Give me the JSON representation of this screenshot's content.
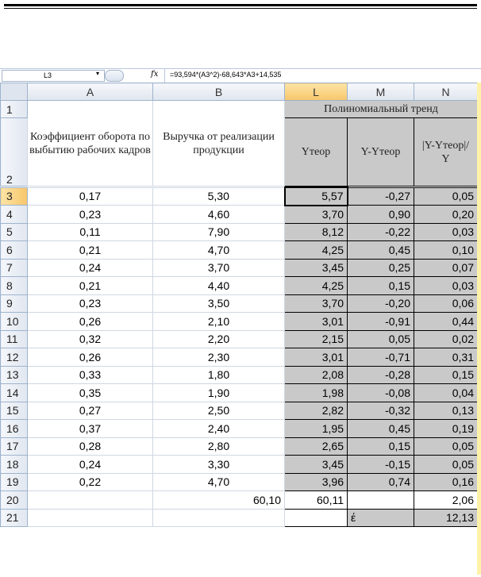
{
  "formula_bar": {
    "cell": "L3",
    "fx_label": "fx",
    "formula": "=93,594*(A3^2)-68,643*A3+14,535"
  },
  "columns": [
    "A",
    "B",
    "L",
    "M",
    "N"
  ],
  "header": {
    "a": "Коэффициент оборота по выбытию рабочих кадров",
    "b": "Выручка от реализации продукции",
    "trend_title": "Полиномиальный тренд",
    "l": "Yтеор",
    "m": "Y-Yтеор",
    "n": "|Y-Yтеор|/Y"
  },
  "rows": [
    {
      "r": "3",
      "a": "0,17",
      "b": "5,30",
      "l": "5,57",
      "m": "-0,27",
      "n": "0,05"
    },
    {
      "r": "4",
      "a": "0,23",
      "b": "4,60",
      "l": "3,70",
      "m": "0,90",
      "n": "0,20"
    },
    {
      "r": "5",
      "a": "0,11",
      "b": "7,90",
      "l": "8,12",
      "m": "-0,22",
      "n": "0,03"
    },
    {
      "r": "6",
      "a": "0,21",
      "b": "4,70",
      "l": "4,25",
      "m": "0,45",
      "n": "0,10"
    },
    {
      "r": "7",
      "a": "0,24",
      "b": "3,70",
      "l": "3,45",
      "m": "0,25",
      "n": "0,07"
    },
    {
      "r": "8",
      "a": "0,21",
      "b": "4,40",
      "l": "4,25",
      "m": "0,15",
      "n": "0,03"
    },
    {
      "r": "9",
      "a": "0,23",
      "b": "3,50",
      "l": "3,70",
      "m": "-0,20",
      "n": "0,06"
    },
    {
      "r": "10",
      "a": "0,26",
      "b": "2,10",
      "l": "3,01",
      "m": "-0,91",
      "n": "0,44"
    },
    {
      "r": "11",
      "a": "0,32",
      "b": "2,20",
      "l": "2,15",
      "m": "0,05",
      "n": "0,02"
    },
    {
      "r": "12",
      "a": "0,26",
      "b": "2,30",
      "l": "3,01",
      "m": "-0,71",
      "n": "0,31"
    },
    {
      "r": "13",
      "a": "0,33",
      "b": "1,80",
      "l": "2,08",
      "m": "-0,28",
      "n": "0,15"
    },
    {
      "r": "14",
      "a": "0,35",
      "b": "1,90",
      "l": "1,98",
      "m": "-0,08",
      "n": "0,04"
    },
    {
      "r": "15",
      "a": "0,27",
      "b": "2,50",
      "l": "2,82",
      "m": "-0,32",
      "n": "0,13"
    },
    {
      "r": "16",
      "a": "0,37",
      "b": "2,40",
      "l": "1,95",
      "m": "0,45",
      "n": "0,19"
    },
    {
      "r": "17",
      "a": "0,28",
      "b": "2,80",
      "l": "2,65",
      "m": "0,15",
      "n": "0,05"
    },
    {
      "r": "18",
      "a": "0,24",
      "b": "3,30",
      "l": "3,45",
      "m": "-0,15",
      "n": "0,05"
    },
    {
      "r": "19",
      "a": "0,22",
      "b": "4,70",
      "l": "3,96",
      "m": "0,74",
      "n": "0,16"
    }
  ],
  "totals": {
    "r": "20",
    "b": "60,10",
    "l": "60,11",
    "n": "2,06"
  },
  "error_row": {
    "r": "21",
    "symbol": "έ",
    "n": "12,13"
  },
  "row_labels": {
    "r1": "1",
    "r2": "2"
  }
}
